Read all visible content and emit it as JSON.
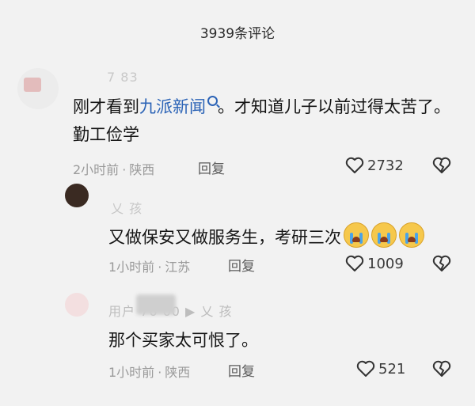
{
  "header": {
    "title": "3939条评论"
  },
  "comments": [
    {
      "username": "7  83",
      "text_before": "刚才看到",
      "link_text": "九派新闻",
      "text_after": "。才知道儿子以前过得太苦了。勤工俭学",
      "time": "2小时前",
      "location": "陕西",
      "reply_label": "回复",
      "likes": "2732"
    },
    {
      "username": "乂  孩",
      "text": "又做保安又做服务生，考研三次",
      "time": "1小时前",
      "location": "江苏",
      "reply_label": "回复",
      "likes": "1009"
    },
    {
      "username": "用户  76  60 ▶ 乂  孩",
      "text": "那个买家太可恨了。",
      "time": "1小时前",
      "location": "陕西",
      "reply_label": "回复",
      "likes": "521"
    }
  ],
  "colors": {
    "link": "#2b63b6",
    "meta": "#9a9a9a",
    "background": "#f2f2f2"
  },
  "icons": {
    "like": "heart-outline-icon",
    "dislike": "broken-heart-icon",
    "emoji": "crying-face-emoji"
  }
}
